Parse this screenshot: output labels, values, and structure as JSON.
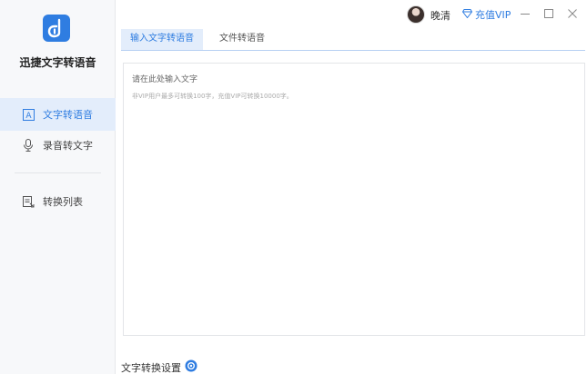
{
  "app": {
    "name": "迅捷文字转语音",
    "brand_color": "#2f7de1"
  },
  "sidebar": {
    "items": [
      {
        "label": "文字转语音",
        "icon": "text-a-icon",
        "active": true
      },
      {
        "label": "录音转文字",
        "icon": "microphone-icon",
        "active": false
      },
      {
        "label": "转换列表",
        "icon": "list-file-icon",
        "active": false
      }
    ]
  },
  "header": {
    "user_name": "晚清",
    "vip_label": "充值VIP",
    "vip_icon": "diamond-icon"
  },
  "tabs": [
    {
      "label": "输入文字转语音",
      "active": true
    },
    {
      "label": "文件转语音",
      "active": false
    }
  ],
  "editor": {
    "placeholder": "请在此处输入文字",
    "hint": "非VIP用户最多可转换100字，充值VIP可转换10000字。"
  },
  "footer": {
    "settings_label": "文字转换设置",
    "settings_icon": "gear-icon"
  }
}
